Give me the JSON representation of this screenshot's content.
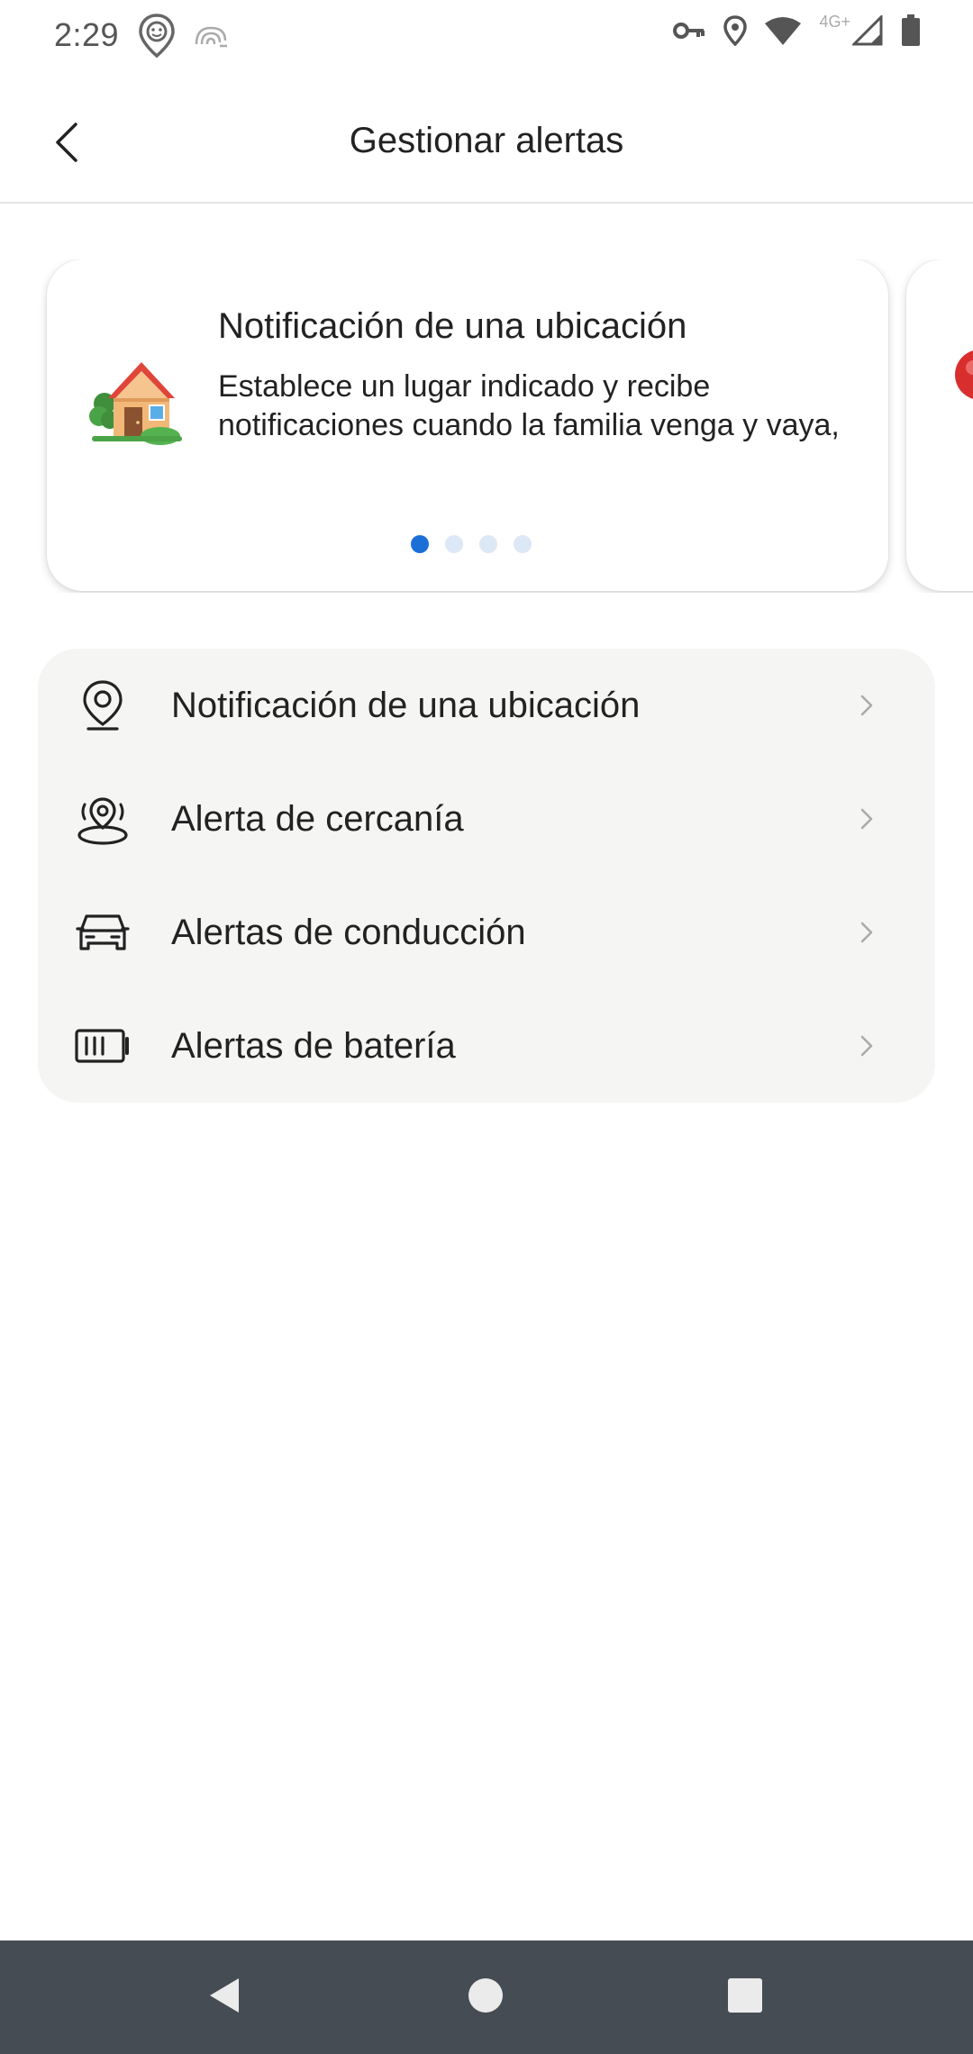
{
  "status_bar": {
    "time": "2:29",
    "network_label": "4G+",
    "left_icons": [
      "face-location-icon",
      "fingerprint-icon"
    ],
    "right_icons": [
      "vpn-key-icon",
      "location-pin-icon",
      "wifi-icon",
      "signal-icon",
      "battery-icon"
    ]
  },
  "app_bar": {
    "title": "Gestionar alertas",
    "back_icon": "chevron-left-icon"
  },
  "carousel": {
    "cards": [
      {
        "icon": "house-icon",
        "title": "Notificación de una ubicación",
        "description": "Establece un lugar indicado y recibe notificaciones cuando la familia venga y vaya,"
      },
      {
        "icon": "pin-icon"
      }
    ],
    "page_count": 4,
    "active_page": 1
  },
  "menu": {
    "items": [
      {
        "label": "Notificación de una ubicación",
        "icon": "location-pin-icon"
      },
      {
        "label": "Alerta de cercanía",
        "icon": "proximity-icon"
      },
      {
        "label": "Alertas de conducción",
        "icon": "car-icon"
      },
      {
        "label": "Alertas de batería",
        "icon": "battery-icon"
      }
    ]
  },
  "nav_bar": {
    "buttons": [
      "back-triangle-icon",
      "home-circle-icon",
      "recents-square-icon"
    ]
  },
  "colors": {
    "accent": "#1d6fd8",
    "dot_inactive": "#dde8f6",
    "menu_background": "#f5f5f4",
    "nav_bar": "#464c53",
    "text": "#222222"
  }
}
